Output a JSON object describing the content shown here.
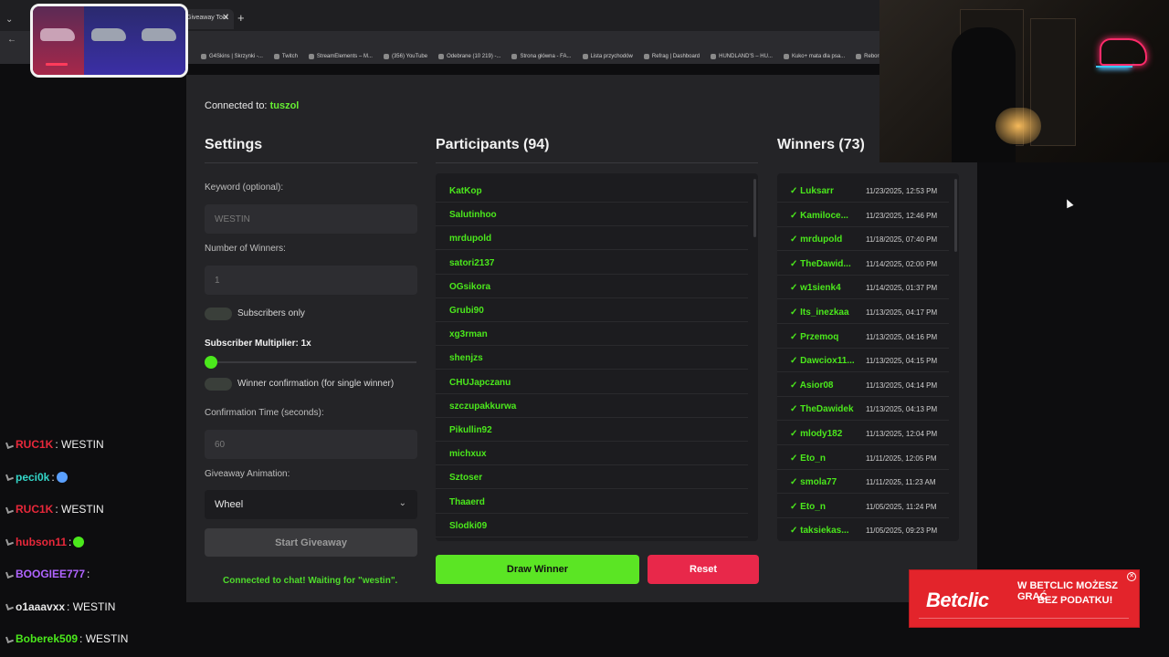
{
  "browser": {
    "tab_title": "Giveaway Tool",
    "bookmarks": [
      "G4Skins | Skrzynki -...",
      "Twitch",
      "StreamElements – M...",
      "(356) YouTube",
      "Odebrane (10 219) -...",
      "Strona główna - FA...",
      "Lista przychodów",
      "Refrag | Dashboard",
      "HUNDLAND'S – HU...",
      "Kuko+ mata dla psa...",
      "Reborn • The He"
    ]
  },
  "app": {
    "connected_prefix": "Connected to: ",
    "channel": "tuszol",
    "settings": {
      "title": "Settings",
      "keyword_label": "Keyword (optional):",
      "keyword_placeholder": "WESTIN",
      "winners_label": "Number of Winners:",
      "winners_value": "1",
      "subs_only_label": "Subscribers only",
      "multiplier_label": "Subscriber Multiplier: 1x",
      "confirm_label": "Winner confirmation (for single winner)",
      "confirm_time_label": "Confirmation Time (seconds):",
      "confirm_time_value": "60",
      "animation_label": "Giveaway Animation:",
      "animation_value": "Wheel",
      "start_label": "Start Giveaway",
      "status": "Connected to chat! Waiting for \"westin\"."
    },
    "participants": {
      "title": "Participants (94)",
      "list": [
        "KatKop",
        "Salutinhoo",
        "mrdupold",
        "satori2137",
        "OGsikora",
        "Grubi90",
        "xg3rman",
        "shenjzs",
        "CHUJapczanu",
        "szczupakkurwa",
        "Pikullin92",
        "michxux",
        "Sztoser",
        "Thaaerd",
        "Slodki09"
      ]
    },
    "draw_label": "Draw Winner",
    "reset_label": "Reset",
    "winners": {
      "title": "Winners (73)",
      "list": [
        {
          "name": "✓ Luksarr",
          "date": "11/23/2025, 12:53 PM"
        },
        {
          "name": "✓ Kamiloce...",
          "date": "11/23/2025, 12:46 PM"
        },
        {
          "name": "✓ mrdupold",
          "date": "11/18/2025, 07:40 PM"
        },
        {
          "name": "✓ TheDawid...",
          "date": "11/14/2025, 02:00 PM"
        },
        {
          "name": "✓ w1sienk4",
          "date": "11/14/2025, 01:37 PM"
        },
        {
          "name": "✓ Its_inezkaa",
          "date": "11/13/2025, 04:17 PM"
        },
        {
          "name": "✓ Przemoq",
          "date": "11/13/2025, 04:16 PM"
        },
        {
          "name": "✓ Dawciox11...",
          "date": "11/13/2025, 04:15 PM"
        },
        {
          "name": "✓ Asior08",
          "date": "11/13/2025, 04:14 PM"
        },
        {
          "name": "✓ TheDawidek",
          "date": "11/13/2025, 04:13 PM"
        },
        {
          "name": "✓ mlody182",
          "date": "11/13/2025, 12:04 PM"
        },
        {
          "name": "✓ Eto_n",
          "date": "11/11/2025, 12:05 PM"
        },
        {
          "name": "✓ smola77",
          "date": "11/11/2025, 11:23 AM"
        },
        {
          "name": "✓ Eto_n",
          "date": "11/05/2025, 11:24 PM"
        },
        {
          "name": "✓ taksiekas...",
          "date": "11/05/2025, 09:23 PM"
        }
      ]
    }
  },
  "chat": [
    {
      "user": "RUC1K",
      "msg": ": WESTIN",
      "color": "#e8283a",
      "emote": ""
    },
    {
      "user": "peci0k",
      "msg": ":",
      "color": "#33d6c8",
      "emote": "#5aa0ff"
    },
    {
      "user": "RUC1K",
      "msg": ": WESTIN",
      "color": "#e8283a",
      "emote": ""
    },
    {
      "user": "hubson11",
      "msg": ":",
      "color": "#e8283a",
      "emote": "#4be81c"
    },
    {
      "user": "BOOGIEE777",
      "msg": ":",
      "color": "#b064ff",
      "emote": ""
    },
    {
      "user": "o1aaavxx",
      "msg": ": WESTIN",
      "color": "#e8e8e8",
      "emote": ""
    },
    {
      "user": "Boberek509",
      "msg": ": WESTIN",
      "color": "#4be81c",
      "emote": ""
    }
  ],
  "ad": {
    "brand": "Betclic",
    "line1": "W BETCLIC MOŻESZ GRAĆ",
    "line2": "BEZ PODATKU!"
  },
  "colors": {
    "accent_green": "#4be81c",
    "draw_button": "#5be524",
    "reset_button": "#e8284a",
    "panel_bg": "#242427"
  }
}
